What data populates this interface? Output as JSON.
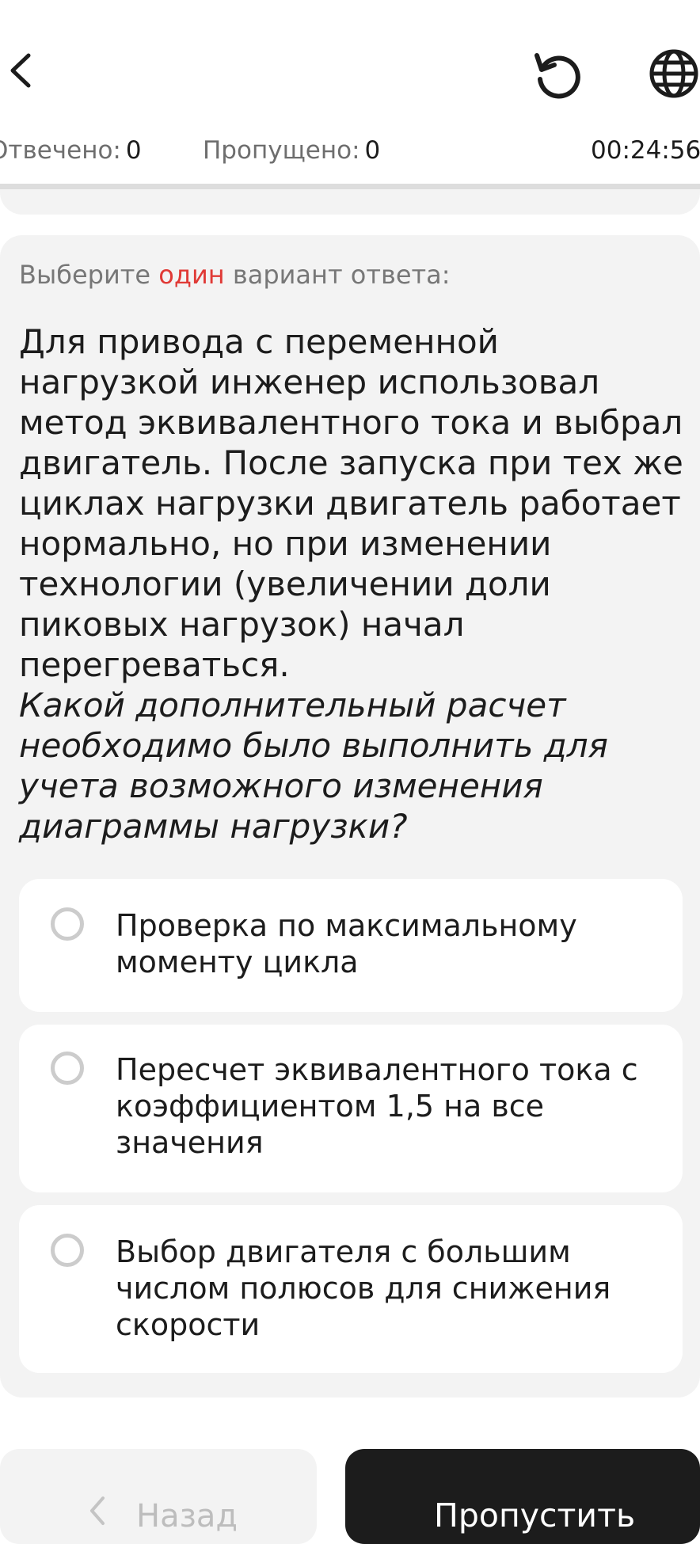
{
  "header": {
    "back_icon": "chevron-left-icon",
    "reset_icon": "reset-icon",
    "language_icon": "globe-icon"
  },
  "stats": {
    "answered_label": "Отвечено:",
    "answered_count": "0",
    "skipped_label": "Пропущено:",
    "skipped_count": "0",
    "timer": "00:24:56"
  },
  "question": {
    "instruction_before": "Выберите",
    "instruction_accent": "один",
    "instruction_after": "вариант ответа:",
    "text": "Для привода с переменной нагрузкой инженер использовал метод эквивалентного тока и выбрал двигатель. После запуска при тех же циклах нагрузки двигатель работает нормально, но при изменении технологии (увеличении доли пиковых нагрузок) начал перегреваться.",
    "prompt": "Какой дополнительный расчет необходимо было выполнить для учета возможного изменения диаграммы нагрузки?"
  },
  "options": [
    {
      "text": "Проверка по максимальному моменту цикла",
      "selected": false
    },
    {
      "text": "Пересчет эквивалентного тока с коэффициентом 1,5 на все значения",
      "selected": false
    },
    {
      "text": "Выбор двигателя с большим числом полюсов для снижения скорости",
      "selected": false
    }
  ],
  "footer": {
    "back_label": "Назад",
    "skip_label": "Пропустить"
  },
  "colors": {
    "accent": "#e03a36",
    "card_background": "#f3f3f3",
    "primary_button": "#1c1c1c"
  }
}
